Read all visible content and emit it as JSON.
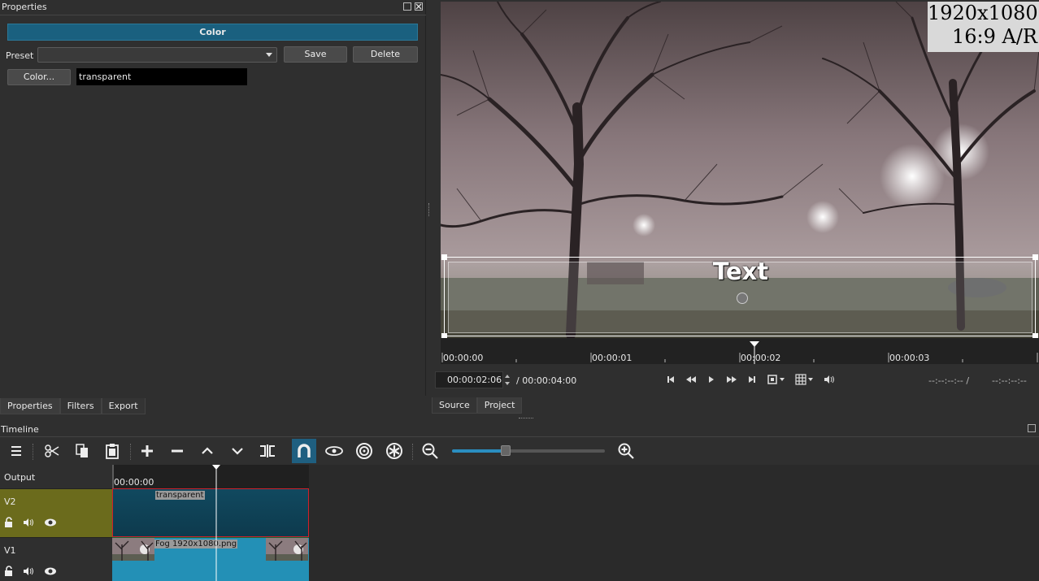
{
  "properties_panel": {
    "title": "Properties",
    "header": "Color",
    "preset_label": "Preset",
    "preset_value": "",
    "save_label": "Save",
    "delete_label": "Delete",
    "color_button_label": "Color...",
    "color_value": "transparent",
    "tabs": [
      "Properties",
      "Filters",
      "Export"
    ]
  },
  "viewer": {
    "resolution_label": "1920x1080",
    "aspect_label": "16:9 A/R",
    "overlay_text": "Text",
    "ruler_ticks": [
      "00:00:00",
      "00:00:01",
      "00:00:02",
      "00:00:03"
    ],
    "current_timecode": "00:00:02:06",
    "duration": "/ 00:00:04:00",
    "in_point": "--:--:--:-- /",
    "out_point": "--:--:--:--",
    "tabs": [
      "Source",
      "Project"
    ]
  },
  "timeline": {
    "title": "Timeline",
    "ruler_start": "00:00:00",
    "zoom_level": 0.35,
    "tracks": [
      {
        "name": "Output"
      },
      {
        "name": "V2",
        "clip": "transparent"
      },
      {
        "name": "V1",
        "clip": "Fog 1920x1080.png"
      }
    ]
  },
  "colors": {
    "accent": "#1a607f",
    "v2_header": "#6b6b1c",
    "clip_v1": "#2390b6",
    "clip_v2": "#11495f",
    "selection": "#d0202a"
  }
}
